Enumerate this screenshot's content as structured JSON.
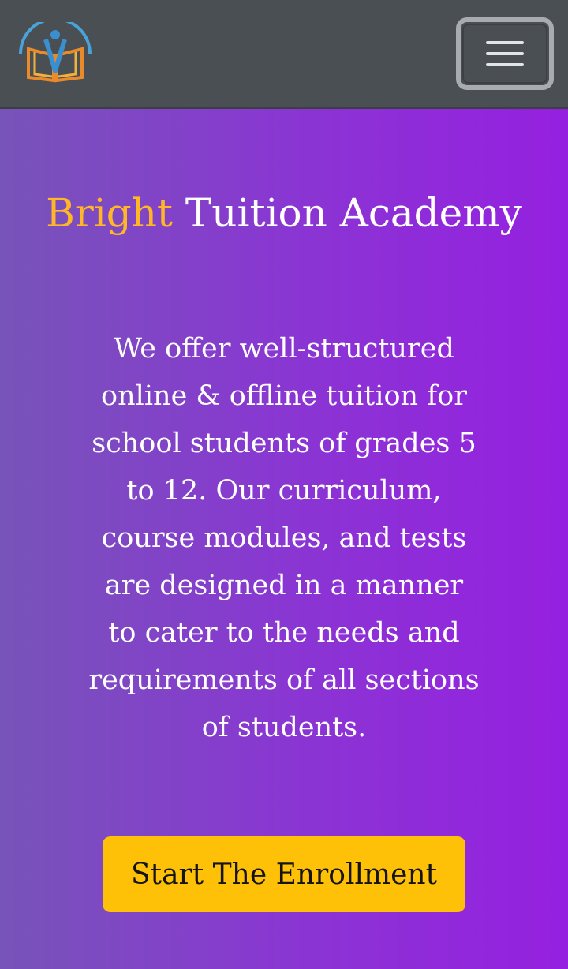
{
  "navbar": {
    "logo_icon": "academy-book-logo",
    "menu_icon": "hamburger-menu-icon"
  },
  "hero": {
    "title_accent": "Bright",
    "title_rest": " Tuition Academy",
    "description": "We offer well-structured online & offline tuition for school students of grades 5 to 12. Our curriculum, course modules, and tests are designed in a manner to cater to the needs and requirements of all sections of students.",
    "cta_label": "Start The Enrollment"
  },
  "colors": {
    "navbar_bg": "#4a4f54",
    "hero_gradient_start": "#7754b9",
    "hero_gradient_end": "#9520e0",
    "accent": "#ffb627",
    "cta_bg": "#ffc107"
  }
}
